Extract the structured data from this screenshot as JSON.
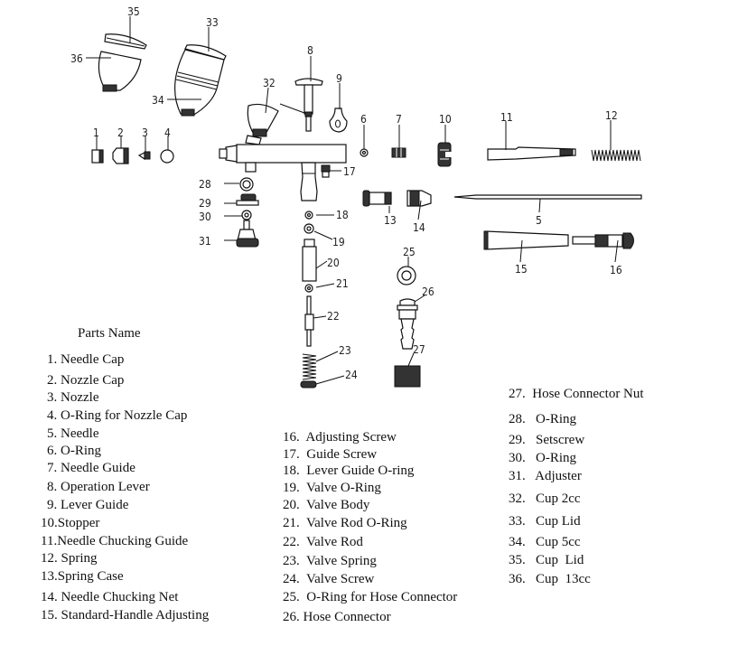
{
  "callouts": [
    "1",
    "2",
    "3",
    "4",
    "5",
    "6",
    "7",
    "8",
    "9",
    "10",
    "11",
    "12",
    "13",
    "14",
    "15",
    "16",
    "17",
    "18",
    "19",
    "20",
    "21",
    "22",
    "23",
    "24",
    "25",
    "26",
    "27",
    "28",
    "29",
    "30",
    "31",
    "32",
    "33",
    "34",
    "35",
    "36"
  ],
  "parts_heading": "Parts Name",
  "parts": [
    "1. Needle Cap",
    "2. Nozzle Cap",
    "3. Nozzle",
    "4. O-Ring for Nozzle Cap",
    "5. Needle",
    "6. O-Ring",
    "7. Needle Guide",
    "8. Operation Lever",
    "9. Lever Guide",
    "10.Stopper",
    "11.Needle Chucking Guide",
    "12. Spring",
    "13.Spring Case",
    "14. Needle Chucking Net",
    "15. Standard-Handle Adjusting",
    "16.  Adjusting Screw",
    "17.  Guide Screw",
    "18.  Lever Guide O-ring",
    "19.  Valve O-Ring",
    "20.  Valve Body",
    "21.  Valve Rod O-Ring",
    "22.  Valve Rod",
    "23.  Valve Spring",
    "24.  Valve Screw",
    "25.  O-Ring for Hose Connector",
    "26. Hose Connector",
    "27.  Hose Connector Nut",
    "28.   O-Ring",
    "29.   Setscrew",
    "30.   O-Ring",
    "31.   Adjuster",
    "32.   Cup 2cc",
    "33.   Cup Lid",
    "34.   Cup 5cc",
    "35.   Cup  Lid",
    "36.   Cup  13cc"
  ]
}
